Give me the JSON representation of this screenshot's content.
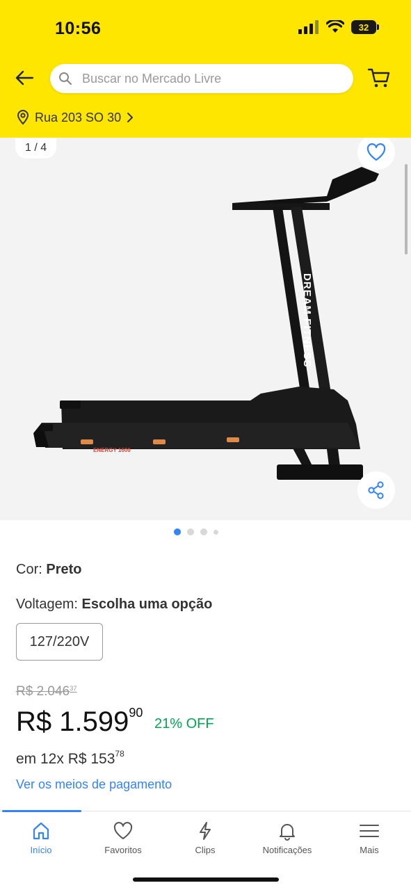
{
  "status_bar": {
    "time": "10:56",
    "battery": "32"
  },
  "search": {
    "placeholder": "Buscar no Mercado Livre"
  },
  "location": {
    "text": "Rua 203 SO 30"
  },
  "gallery": {
    "counter": "1 / 4",
    "current_image": 1,
    "total_images": 4,
    "product_brand_text": "DREAM FITNESS",
    "product_model_text": "ENERGY 1600"
  },
  "attributes": {
    "color_label": "Cor:",
    "color_value": "Preto",
    "voltage_label": "Voltagem:",
    "voltage_value": "Escolha uma opção",
    "voltage_option": "127/220V"
  },
  "pricing": {
    "old_price_main": "R$ 2.046",
    "old_price_cents": "37",
    "price_main": "R$ 1.599",
    "price_cents": "90",
    "discount": "21% OFF",
    "installments_main": "em 12x R$ 153",
    "installments_cents": "78",
    "payment_link": "Ver os meios de pagamento"
  },
  "bottom_nav": {
    "items": [
      {
        "label": "Início",
        "icon": "home-icon",
        "active": true
      },
      {
        "label": "Favoritos",
        "icon": "heart-icon",
        "active": false
      },
      {
        "label": "Clips",
        "icon": "lightning-icon",
        "active": false
      },
      {
        "label": "Notificações",
        "icon": "bell-icon",
        "active": false
      },
      {
        "label": "Mais",
        "icon": "menu-icon",
        "active": false
      }
    ]
  },
  "colors": {
    "header_bg": "#ffe600",
    "accent_blue": "#3483fa",
    "discount_green": "#00a650"
  }
}
